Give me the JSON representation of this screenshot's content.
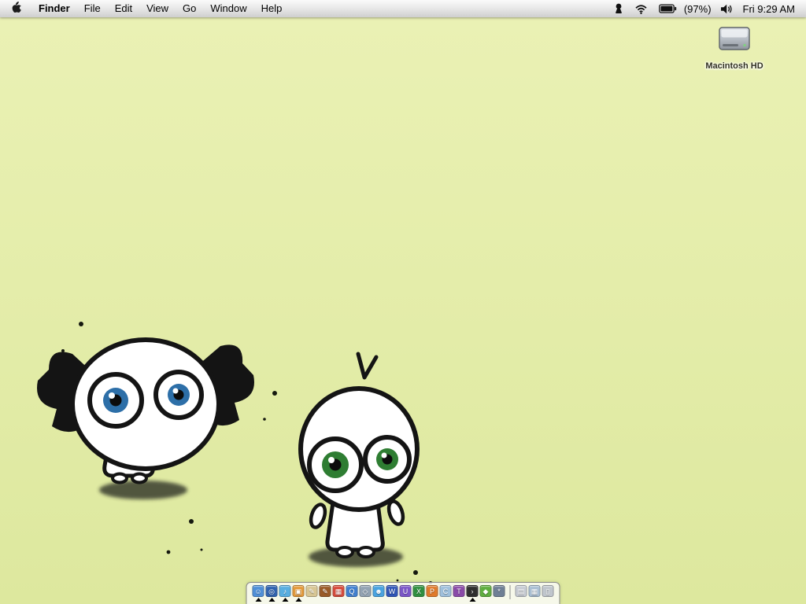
{
  "menu_bar": {
    "menus": [
      {
        "label": "Finder",
        "bold": true
      },
      {
        "label": "File",
        "bold": false
      },
      {
        "label": "Edit",
        "bold": false
      },
      {
        "label": "View",
        "bold": false
      },
      {
        "label": "Go",
        "bold": false
      },
      {
        "label": "Window",
        "bold": false
      },
      {
        "label": "Help",
        "bold": false
      }
    ],
    "status": {
      "battery_label": "(97%)",
      "clock": "Fri 9:29 AM"
    }
  },
  "desktop": {
    "background_top": "#eaf1b4",
    "background_bottom": "#dde89e",
    "hd_icon_label": "Macintosh HD"
  },
  "dock": {
    "apps": [
      {
        "name": "finder",
        "glyph": "☺",
        "color": "#4f8fd8",
        "running": true
      },
      {
        "name": "web-browser",
        "glyph": "◎",
        "color": "#2f62b0",
        "running": true
      },
      {
        "name": "music",
        "glyph": "♪",
        "color": "#58aee0",
        "running": true
      },
      {
        "name": "photos",
        "glyph": "▣",
        "color": "#e59a3a",
        "running": true
      },
      {
        "name": "sketch",
        "glyph": "✎",
        "color": "#d8c694",
        "running": false
      },
      {
        "name": "draw",
        "glyph": "✎",
        "color": "#9a5a28",
        "running": false
      },
      {
        "name": "calendar",
        "glyph": "▦",
        "color": "#d84a3a",
        "running": false
      },
      {
        "name": "quicktime",
        "glyph": "Q",
        "color": "#3f7fd0",
        "running": false
      },
      {
        "name": "preview",
        "glyph": "◇",
        "color": "#93a3b3",
        "running": false
      },
      {
        "name": "chat",
        "glyph": "☻",
        "color": "#49a3e0",
        "running": false
      },
      {
        "name": "word",
        "glyph": "W",
        "color": "#2f55b8",
        "running": false
      },
      {
        "name": "utility",
        "glyph": "U",
        "color": "#7a55c8",
        "running": false
      },
      {
        "name": "excel",
        "glyph": "X",
        "color": "#2f8f3f",
        "running": false
      },
      {
        "name": "powerpoint",
        "glyph": "P",
        "color": "#e07a2a",
        "running": false
      },
      {
        "name": "contacts",
        "glyph": "C",
        "color": "#9fc0dc",
        "running": false
      },
      {
        "name": "tools",
        "glyph": "T",
        "color": "#8a4aa8",
        "running": false
      },
      {
        "name": "terminal",
        "glyph": "›",
        "color": "#2f2f2f",
        "running": true
      },
      {
        "name": "sharing",
        "glyph": "◆",
        "color": "#5fae3f",
        "running": false
      },
      {
        "name": "settings",
        "glyph": "*",
        "color": "#6f7f95",
        "running": false
      }
    ],
    "documents": [
      {
        "name": "document-file",
        "glyph": "▤",
        "color": "#c7ccd4",
        "running": false
      },
      {
        "name": "picture-file",
        "glyph": "▦",
        "color": "#a9bfd4",
        "running": false
      },
      {
        "name": "trash",
        "glyph": "▯",
        "color": "#c0c6cd",
        "running": false
      }
    ]
  }
}
